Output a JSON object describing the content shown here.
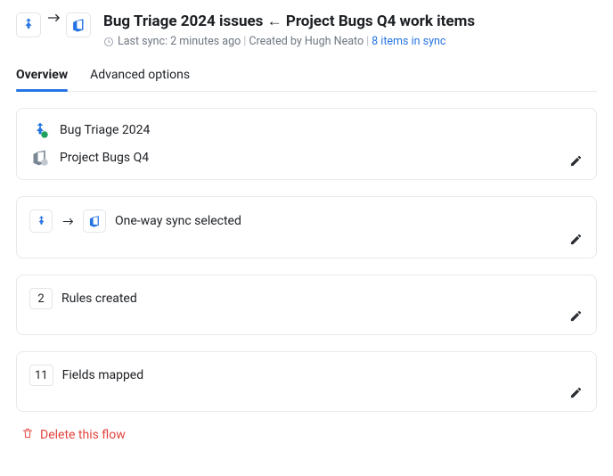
{
  "header": {
    "title": "Bug Triage 2024 issues ← Project Bugs Q4 work items",
    "last_sync": "Last sync: 2 minutes ago",
    "created_by": "Created by Hugh Neato",
    "sync_link": "8 items in sync"
  },
  "tabs": {
    "overview": "Overview",
    "advanced": "Advanced options"
  },
  "projects": {
    "source": "Bug Triage 2024",
    "target": "Project Bugs Q4"
  },
  "sync": {
    "label": "One-way sync selected"
  },
  "rules": {
    "count": "2",
    "label": "Rules created"
  },
  "fields": {
    "count": "11",
    "label": "Fields mapped"
  },
  "delete": {
    "label": "Delete this flow"
  }
}
